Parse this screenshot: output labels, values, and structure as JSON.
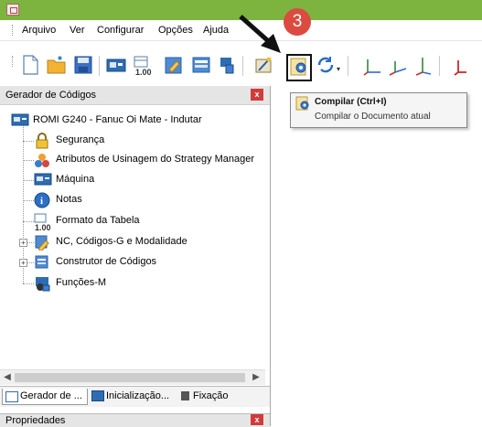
{
  "menu": {
    "items": [
      "Arquivo",
      "Ver",
      "Configurar",
      "Opções",
      "Ajuda"
    ]
  },
  "toolbar": {
    "icons": [
      "new-file-icon",
      "open-folder-icon",
      "save-icon",
      "machine-icon",
      "format-table-icon",
      "edit-icon",
      "list-icon",
      "tool-icon",
      "wizard-icon",
      "compile-icon",
      "refresh-icon",
      "axis-x-icon",
      "axis-y-icon",
      "axis-z-icon",
      "axis-red-icon"
    ]
  },
  "left_panel": {
    "title": "Gerador de Códigos",
    "close_label": "x",
    "tree": {
      "root": "ROMI G240 - Fanuc Oi Mate - Indutar",
      "children": [
        "Segurança",
        "Atributos de Usinagem do Strategy Manager",
        "Máquina",
        "Notas",
        "Formato da Tabela",
        "NC, Códigos-G e Modalidade",
        "Construtor de Códigos",
        "Funções-M"
      ]
    },
    "tabs": [
      "Gerador de ...",
      "Inicialização...",
      "Fixação"
    ]
  },
  "properties": {
    "title": "Propriedades",
    "close_label": "x"
  },
  "tooltip": {
    "title": "Compilar (Ctrl+I)",
    "description": "Compilar o Documento atual"
  },
  "annotation": {
    "step_number": "3",
    "color": "#dc4b40"
  },
  "colors": {
    "titlebar": "#7db33f",
    "close_button": "#d23b3b"
  }
}
